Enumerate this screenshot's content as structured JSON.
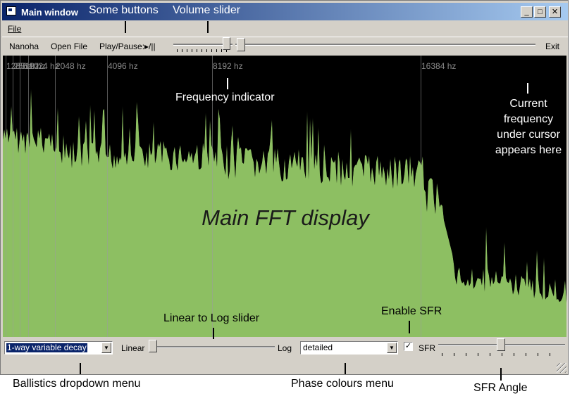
{
  "window": {
    "title": "Main window",
    "controls": [
      "_",
      "□",
      "✕"
    ]
  },
  "menu": {
    "file": "File"
  },
  "toolbar": {
    "nanoha": "Nanoha",
    "open_file": "Open File",
    "play_pause": "Play/Pause:▸/||",
    "exit": "Exit"
  },
  "fft": {
    "frequency_labels": [
      "128 hz",
      "256 hz",
      "512 hz",
      "1024 hz",
      "2048 hz",
      "4096 hz",
      "8192 hz",
      "16384 hz"
    ],
    "bar_color": "#8dbf62",
    "background_color": "#000000"
  },
  "bottom": {
    "ballistics_value": "1-way variable decay",
    "linear_label": "Linear",
    "log_label": "Log",
    "phase_value": "detailed",
    "sfr_checked": "✓",
    "sfr_label": "SFR"
  },
  "annotations": {
    "some_buttons": "Some buttons",
    "volume_slider": "Volume slider",
    "frequency_indicator": "Frequency indicator",
    "current_frequency": [
      "Current",
      "frequency",
      "under cursor",
      "appears here"
    ],
    "main_fft": "Main FFT display",
    "linear_to_log": "Linear to Log slider",
    "enable_sfr": "Enable SFR",
    "ballistics_menu": "Ballistics dropdown menu",
    "phase_menu": "Phase colours menu",
    "sfr_angle": "SFR Angle"
  },
  "colors": {
    "titlebar_start": "#0a246a",
    "titlebar_end": "#a6caf0",
    "selection": "#0a246a"
  }
}
